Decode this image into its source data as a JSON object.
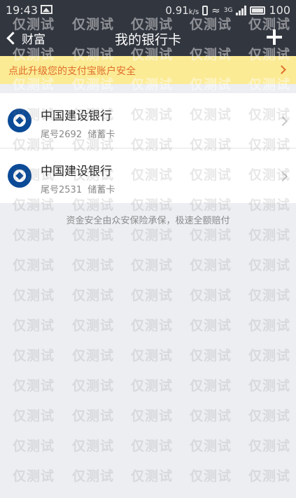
{
  "status_bar": {
    "time": "19:43",
    "battery_percent": "0.91",
    "battery_unit": "k/s",
    "network": "3G",
    "battery": "100"
  },
  "nav": {
    "back_label": "财富",
    "title": "我的银行卡",
    "add_icon": "plus-icon"
  },
  "notice": {
    "text": "点此升级您的支付宝账户安全"
  },
  "cards": [
    {
      "bank": "中国建设银行",
      "tail": "尾号2692",
      "type": "储蓄卡"
    },
    {
      "bank": "中国建设银行",
      "tail": "尾号2531",
      "type": "储蓄卡"
    }
  ],
  "footer_note": "资金安全由众安保险承保，极速全额赔付",
  "watermark": "仅测试",
  "colors": {
    "header": "#32363f",
    "notice_bg": "#fbeb95",
    "notice_text": "#e06e2c",
    "bank_blue": "#0b4a97"
  }
}
